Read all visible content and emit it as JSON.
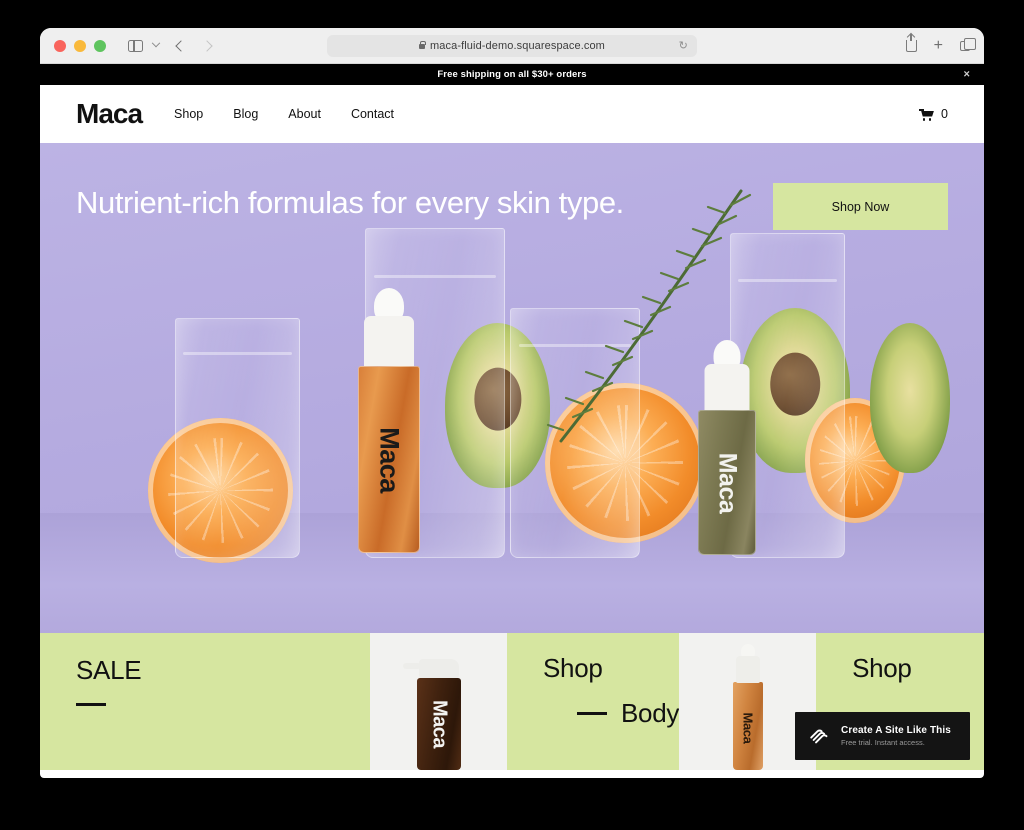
{
  "browser": {
    "url": "maca-fluid-demo.squarespace.com",
    "lock_icon": "lock-icon",
    "reload_icon": "↻",
    "sidebar_icon": "sidebar-toggle-icon",
    "back_icon": "back-arrow-icon",
    "forward_icon": "forward-arrow-icon",
    "share_icon": "share-icon",
    "new_tab_icon": "+",
    "tabs_icon": "tabs-overview-icon",
    "traffic_lights": [
      "close",
      "minimize",
      "zoom"
    ]
  },
  "announcement": {
    "text": "Free shipping on all $30+ orders",
    "close_label": "×"
  },
  "header": {
    "logo": "Maca",
    "nav": [
      {
        "label": "Shop"
      },
      {
        "label": "Blog"
      },
      {
        "label": "About"
      },
      {
        "label": "Contact"
      }
    ],
    "cart_icon": "shopping-cart-icon",
    "cart_count": "0"
  },
  "hero": {
    "headline": "Nutrient-rich formulas for every skin type.",
    "cta_label": "Shop Now",
    "bottle_amber_label": "Maca",
    "bottle_olive_label": "Maca"
  },
  "strip": {
    "sale_title": "SALE",
    "shop_body_title": "Shop",
    "body_text": "Body",
    "shop_title": "Shop",
    "thumb1_label": "Maca",
    "thumb2_label": "Maca"
  },
  "badge": {
    "title": "Create A Site Like This",
    "subtitle": "Free trial. Instant access.",
    "logo_icon": "squarespace-logo-icon"
  },
  "colors": {
    "accent_green": "#d6e6a0",
    "hero_purple": "#b5abe0",
    "black": "#000000",
    "white": "#ffffff"
  }
}
